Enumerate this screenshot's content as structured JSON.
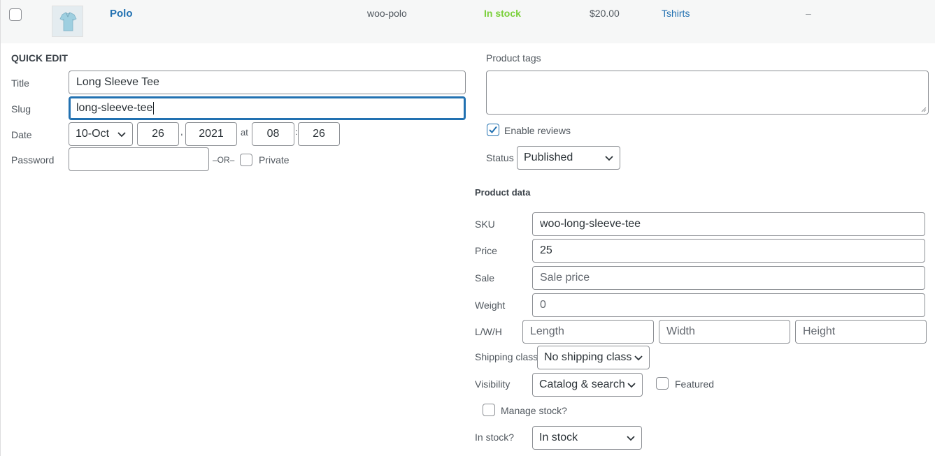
{
  "product_row": {
    "name": "Polo",
    "sku": "woo-polo",
    "stock": "In stock",
    "price": "$20.00",
    "category": "Tshirts",
    "tags": "–",
    "stock_color": "#7ad03a"
  },
  "quick_edit": {
    "heading": "QUICK EDIT",
    "title_label": "Title",
    "title_value": "Long Sleeve Tee",
    "slug_label": "Slug",
    "slug_value": "long-sleeve-tee",
    "date_label": "Date",
    "date_month": "10-Oct",
    "date_day": "26",
    "date_sep": ",",
    "date_year": "2021",
    "date_at": "at",
    "date_hour": "08",
    "date_colon": ":",
    "date_minute": "26",
    "password_label": "Password",
    "password_value": "",
    "or_text": "–OR–",
    "private_label": "Private"
  },
  "right": {
    "tags_label": "Product tags",
    "tags_value": "",
    "enable_reviews_label": "Enable reviews",
    "enable_reviews_checked": true,
    "status_label": "Status",
    "status_value": "Published"
  },
  "product_data": {
    "heading": "Product data",
    "sku_label": "SKU",
    "sku_value": "woo-long-sleeve-tee",
    "price_label": "Price",
    "price_value": "25",
    "sale_label": "Sale",
    "sale_placeholder": "Sale price",
    "weight_label": "Weight",
    "weight_placeholder": "0",
    "lwh_label": "L/W/H",
    "length_placeholder": "Length",
    "width_placeholder": "Width",
    "height_placeholder": "Height",
    "shipping_label": "Shipping class",
    "shipping_value": "No shipping class",
    "visibility_label": "Visibility",
    "visibility_value": "Catalog & search",
    "featured_label": "Featured",
    "manage_stock_label": "Manage stock?",
    "instock_label": "In stock?",
    "instock_value": "In stock"
  },
  "colors": {
    "link": "#2271b1",
    "border": "#8c8f94",
    "row_bg": "#f6f7f7",
    "in_stock": "#7ad03a"
  }
}
